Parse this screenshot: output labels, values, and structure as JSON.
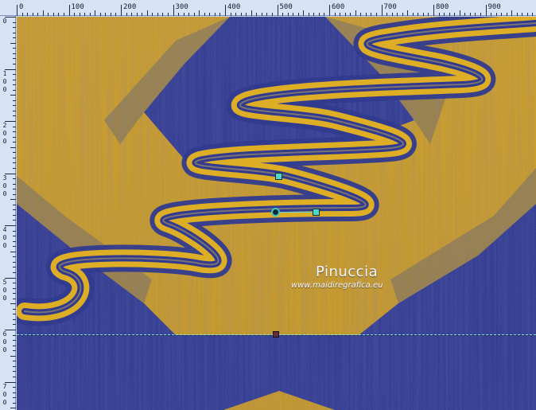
{
  "ruler": {
    "horizontal_labels": [
      "0",
      "100",
      "200",
      "300",
      "400",
      "500",
      "600",
      "700",
      "800",
      "900"
    ],
    "vertical_labels": [
      [
        "0"
      ],
      [
        "1",
        "0",
        "0"
      ],
      [
        "2",
        "0",
        "0"
      ],
      [
        "3",
        "0",
        "0"
      ],
      [
        "4",
        "0",
        "0"
      ],
      [
        "5",
        "0",
        "0"
      ],
      [
        "6",
        "0",
        "0"
      ],
      [
        "7",
        "0",
        "0"
      ]
    ]
  },
  "watermark": {
    "name": "Pinuccia",
    "url": "www.maidiregrafica.eu"
  },
  "colors": {
    "gold": "#d9a416",
    "blue": "#27308f",
    "ruler_bg": "#d7e2f4",
    "guide": "#7fe6ea",
    "handle": "#4fd6c8"
  },
  "icons": {
    "deformation_handle": "square-handle",
    "rotation_pivot": "circle-pivot",
    "guide_marker": "square-marker"
  }
}
